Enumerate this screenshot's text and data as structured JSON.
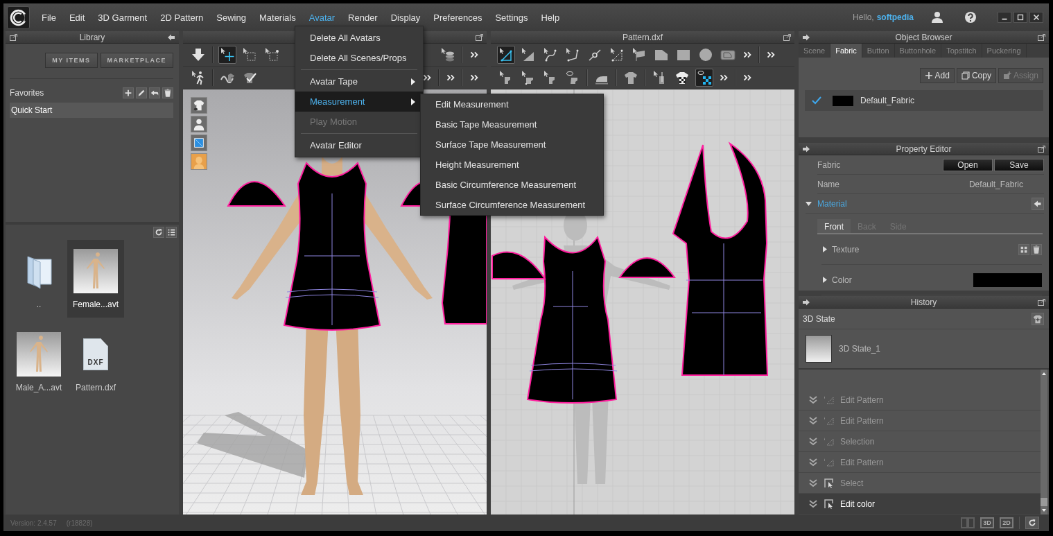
{
  "menu_bar": {
    "items": [
      {
        "label": "File",
        "selected": false
      },
      {
        "label": "Edit",
        "selected": false
      },
      {
        "label": "3D Garment",
        "selected": false
      },
      {
        "label": "2D Pattern",
        "selected": false
      },
      {
        "label": "Sewing",
        "selected": false
      },
      {
        "label": "Materials",
        "selected": false
      },
      {
        "label": "Avatar",
        "selected": true
      },
      {
        "label": "Render",
        "selected": false
      },
      {
        "label": "Display",
        "selected": false
      },
      {
        "label": "Preferences",
        "selected": false
      },
      {
        "label": "Settings",
        "selected": false
      },
      {
        "label": "Help",
        "selected": false
      }
    ],
    "greeting": "Hello,",
    "user_name": "softpedia"
  },
  "avatar_menu": {
    "items": [
      {
        "kind": "action",
        "label": "Delete All Avatars",
        "selected": false,
        "disabled": false
      },
      {
        "kind": "action",
        "label": "Delete All Scenes/Props",
        "selected": false,
        "disabled": false
      },
      {
        "kind": "separator"
      },
      {
        "kind": "submenu",
        "label": "Avatar Tape",
        "selected": false,
        "disabled": false
      },
      {
        "kind": "submenu",
        "label": "Measurement",
        "selected": true,
        "disabled": false
      },
      {
        "kind": "action",
        "label": "Play Motion",
        "selected": false,
        "disabled": true
      },
      {
        "kind": "separator"
      },
      {
        "kind": "action",
        "label": "Avatar Editor",
        "selected": false,
        "disabled": false
      }
    ],
    "submenu": [
      "Edit Measurement",
      "Basic Tape Measurement",
      "Surface Tape Measurement",
      "Height Measurement",
      "Basic Circumference Measurement",
      "Surface Circumference Measurement"
    ]
  },
  "library": {
    "title": "Library",
    "buttons": [
      "MY ITEMS",
      "MARKETPLACE"
    ],
    "favorites_title": "Favorites",
    "favorites": [
      {
        "label": "Quick Start",
        "selected": true
      }
    ],
    "files": [
      {
        "kind": "folder",
        "name": "..",
        "selected": false
      },
      {
        "kind": "avatar",
        "name": "Female...avt",
        "selected": true
      },
      {
        "kind": "avatar",
        "name": "Male_A...avt",
        "selected": false
      },
      {
        "kind": "document",
        "name": "Pattern.dxf",
        "badge": "DXF",
        "selected": false
      }
    ]
  },
  "view_2d": {
    "title": "Pattern.dxf"
  },
  "object_browser": {
    "title": "Object Browser",
    "tabs": [
      {
        "label": "Scene",
        "selected": false
      },
      {
        "label": "Fabric",
        "selected": true
      },
      {
        "label": "Button",
        "selected": false
      },
      {
        "label": "Buttonhole",
        "selected": false
      },
      {
        "label": "Topstitch",
        "selected": false
      },
      {
        "label": "Puckering",
        "selected": false
      }
    ],
    "actions": [
      {
        "label": "Add",
        "disabled": false
      },
      {
        "label": "Copy",
        "disabled": false
      },
      {
        "label": "Assign",
        "disabled": true
      }
    ],
    "fabrics": [
      {
        "name": "Default_Fabric",
        "checked": true
      }
    ]
  },
  "property_editor": {
    "title": "Property Editor",
    "fabric_label": "Fabric",
    "buttons": [
      "Open",
      "Save"
    ],
    "name_label": "Name",
    "name_value": "Default_Fabric",
    "section": {
      "label": "Material",
      "expanded": true
    },
    "tabs": [
      {
        "label": "Front",
        "selected": true
      },
      {
        "label": "Back",
        "selected": false
      },
      {
        "label": "Side",
        "selected": false
      }
    ],
    "properties": [
      {
        "kind": "texture",
        "label": "Texture",
        "expanded": false
      },
      {
        "kind": "color",
        "label": "Color",
        "expanded": false
      }
    ]
  },
  "history": {
    "title": "History",
    "group_label": "3D State",
    "states": [
      {
        "label": "3D State_1"
      }
    ],
    "steps": [
      {
        "kind": "pattern",
        "label": "Edit Pattern",
        "selected": false
      },
      {
        "kind": "pattern",
        "label": "Edit Pattern",
        "selected": false
      },
      {
        "kind": "pattern",
        "label": "Selection",
        "selected": false
      },
      {
        "kind": "pattern",
        "label": "Edit Pattern",
        "selected": false
      },
      {
        "kind": "select",
        "label": "Select",
        "selected": false
      },
      {
        "kind": "select",
        "label": "Edit color",
        "selected": true
      }
    ]
  },
  "status_bar": {
    "version": "Version: 2.4.57",
    "revision": "(r18828)",
    "view_buttons": [
      "3D",
      "2D"
    ]
  }
}
